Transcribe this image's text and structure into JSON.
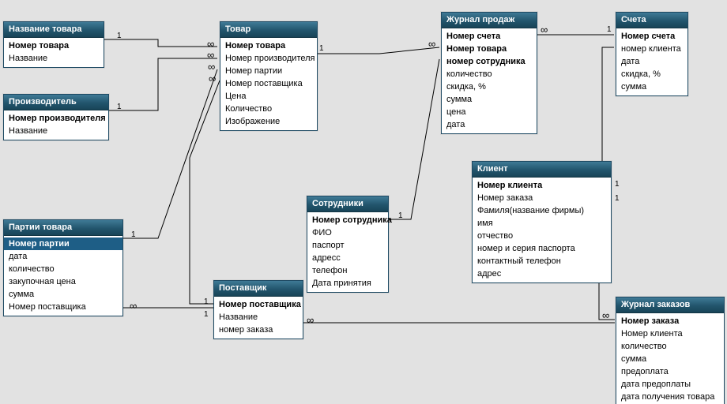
{
  "tables": {
    "t0": {
      "title": "Название товара",
      "fields": [
        {
          "n": "Номер товара",
          "pk": true
        },
        {
          "n": "Название"
        }
      ]
    },
    "t1": {
      "title": "Производитель",
      "fields": [
        {
          "n": "Номер производителя",
          "pk": true
        },
        {
          "n": "Название"
        }
      ]
    },
    "t2": {
      "title": "Товар",
      "fields": [
        {
          "n": "Номер товара",
          "pk": true
        },
        {
          "n": "Номер производителя"
        },
        {
          "n": "Номер партии"
        },
        {
          "n": "Номер поставщика"
        },
        {
          "n": "Цена"
        },
        {
          "n": "Количество"
        },
        {
          "n": "Изображение"
        }
      ]
    },
    "t3": {
      "title": "Журнал продаж",
      "fields": [
        {
          "n": "Номер счета",
          "pk": true
        },
        {
          "n": "Номер товара",
          "pk": true
        },
        {
          "n": "номер сотрудника",
          "pk": true
        },
        {
          "n": "количество"
        },
        {
          "n": "скидка, %"
        },
        {
          "n": "сумма"
        },
        {
          "n": "цена"
        },
        {
          "n": "дата"
        }
      ]
    },
    "t4": {
      "title": "Счета",
      "fields": [
        {
          "n": "Номер счета",
          "pk": true
        },
        {
          "n": "номер клиента"
        },
        {
          "n": "дата"
        },
        {
          "n": "скидка, %"
        },
        {
          "n": "сумма"
        }
      ]
    },
    "t5": {
      "title": "Партии товара",
      "fields": [
        {
          "n": "Номер партии",
          "pk": true,
          "sel": true
        },
        {
          "n": "дата"
        },
        {
          "n": "количество"
        },
        {
          "n": "закупочная цена"
        },
        {
          "n": "сумма"
        },
        {
          "n": "Номер поставщика"
        }
      ]
    },
    "t6": {
      "title": "Сотрудники",
      "fields": [
        {
          "n": "Номер сотрудника",
          "pk": true
        },
        {
          "n": "ФИО"
        },
        {
          "n": "паспорт"
        },
        {
          "n": "адресс"
        },
        {
          "n": "телефон"
        },
        {
          "n": "Дата принятия"
        }
      ]
    },
    "t7": {
      "title": "Клиент",
      "fields": [
        {
          "n": "Номер клиента",
          "pk": true
        },
        {
          "n": "Номер заказа"
        },
        {
          "n": "Фамиля(название фирмы)"
        },
        {
          "n": "имя"
        },
        {
          "n": "отчество"
        },
        {
          "n": "номер и серия паспорта"
        },
        {
          "n": "контактный телефон"
        },
        {
          "n": "адрес"
        }
      ]
    },
    "t8": {
      "title": "Поставщик",
      "fields": [
        {
          "n": "Номер поставщика",
          "pk": true
        },
        {
          "n": "Название"
        },
        {
          "n": "номер заказа"
        }
      ]
    },
    "t9": {
      "title": "Журнал заказов",
      "fields": [
        {
          "n": "Номер заказа",
          "pk": true
        },
        {
          "n": "Номер клиента"
        },
        {
          "n": "количество"
        },
        {
          "n": "сумма"
        },
        {
          "n": "предоплата"
        },
        {
          "n": "дата предоплаты"
        },
        {
          "n": "дата получения товара"
        }
      ]
    }
  },
  "cards": {
    "c1": "1",
    "c2": "1",
    "c3": "1",
    "c4": "1",
    "c5": "1",
    "c6": "1",
    "c7": "1",
    "c8": "1",
    "c9": "1",
    "c10": "1",
    "i1": "∞",
    "i2": "∞",
    "i3": "∞",
    "i4": "∞",
    "i5": "∞",
    "i6": "∞",
    "i7": "∞",
    "i8": "∞"
  }
}
